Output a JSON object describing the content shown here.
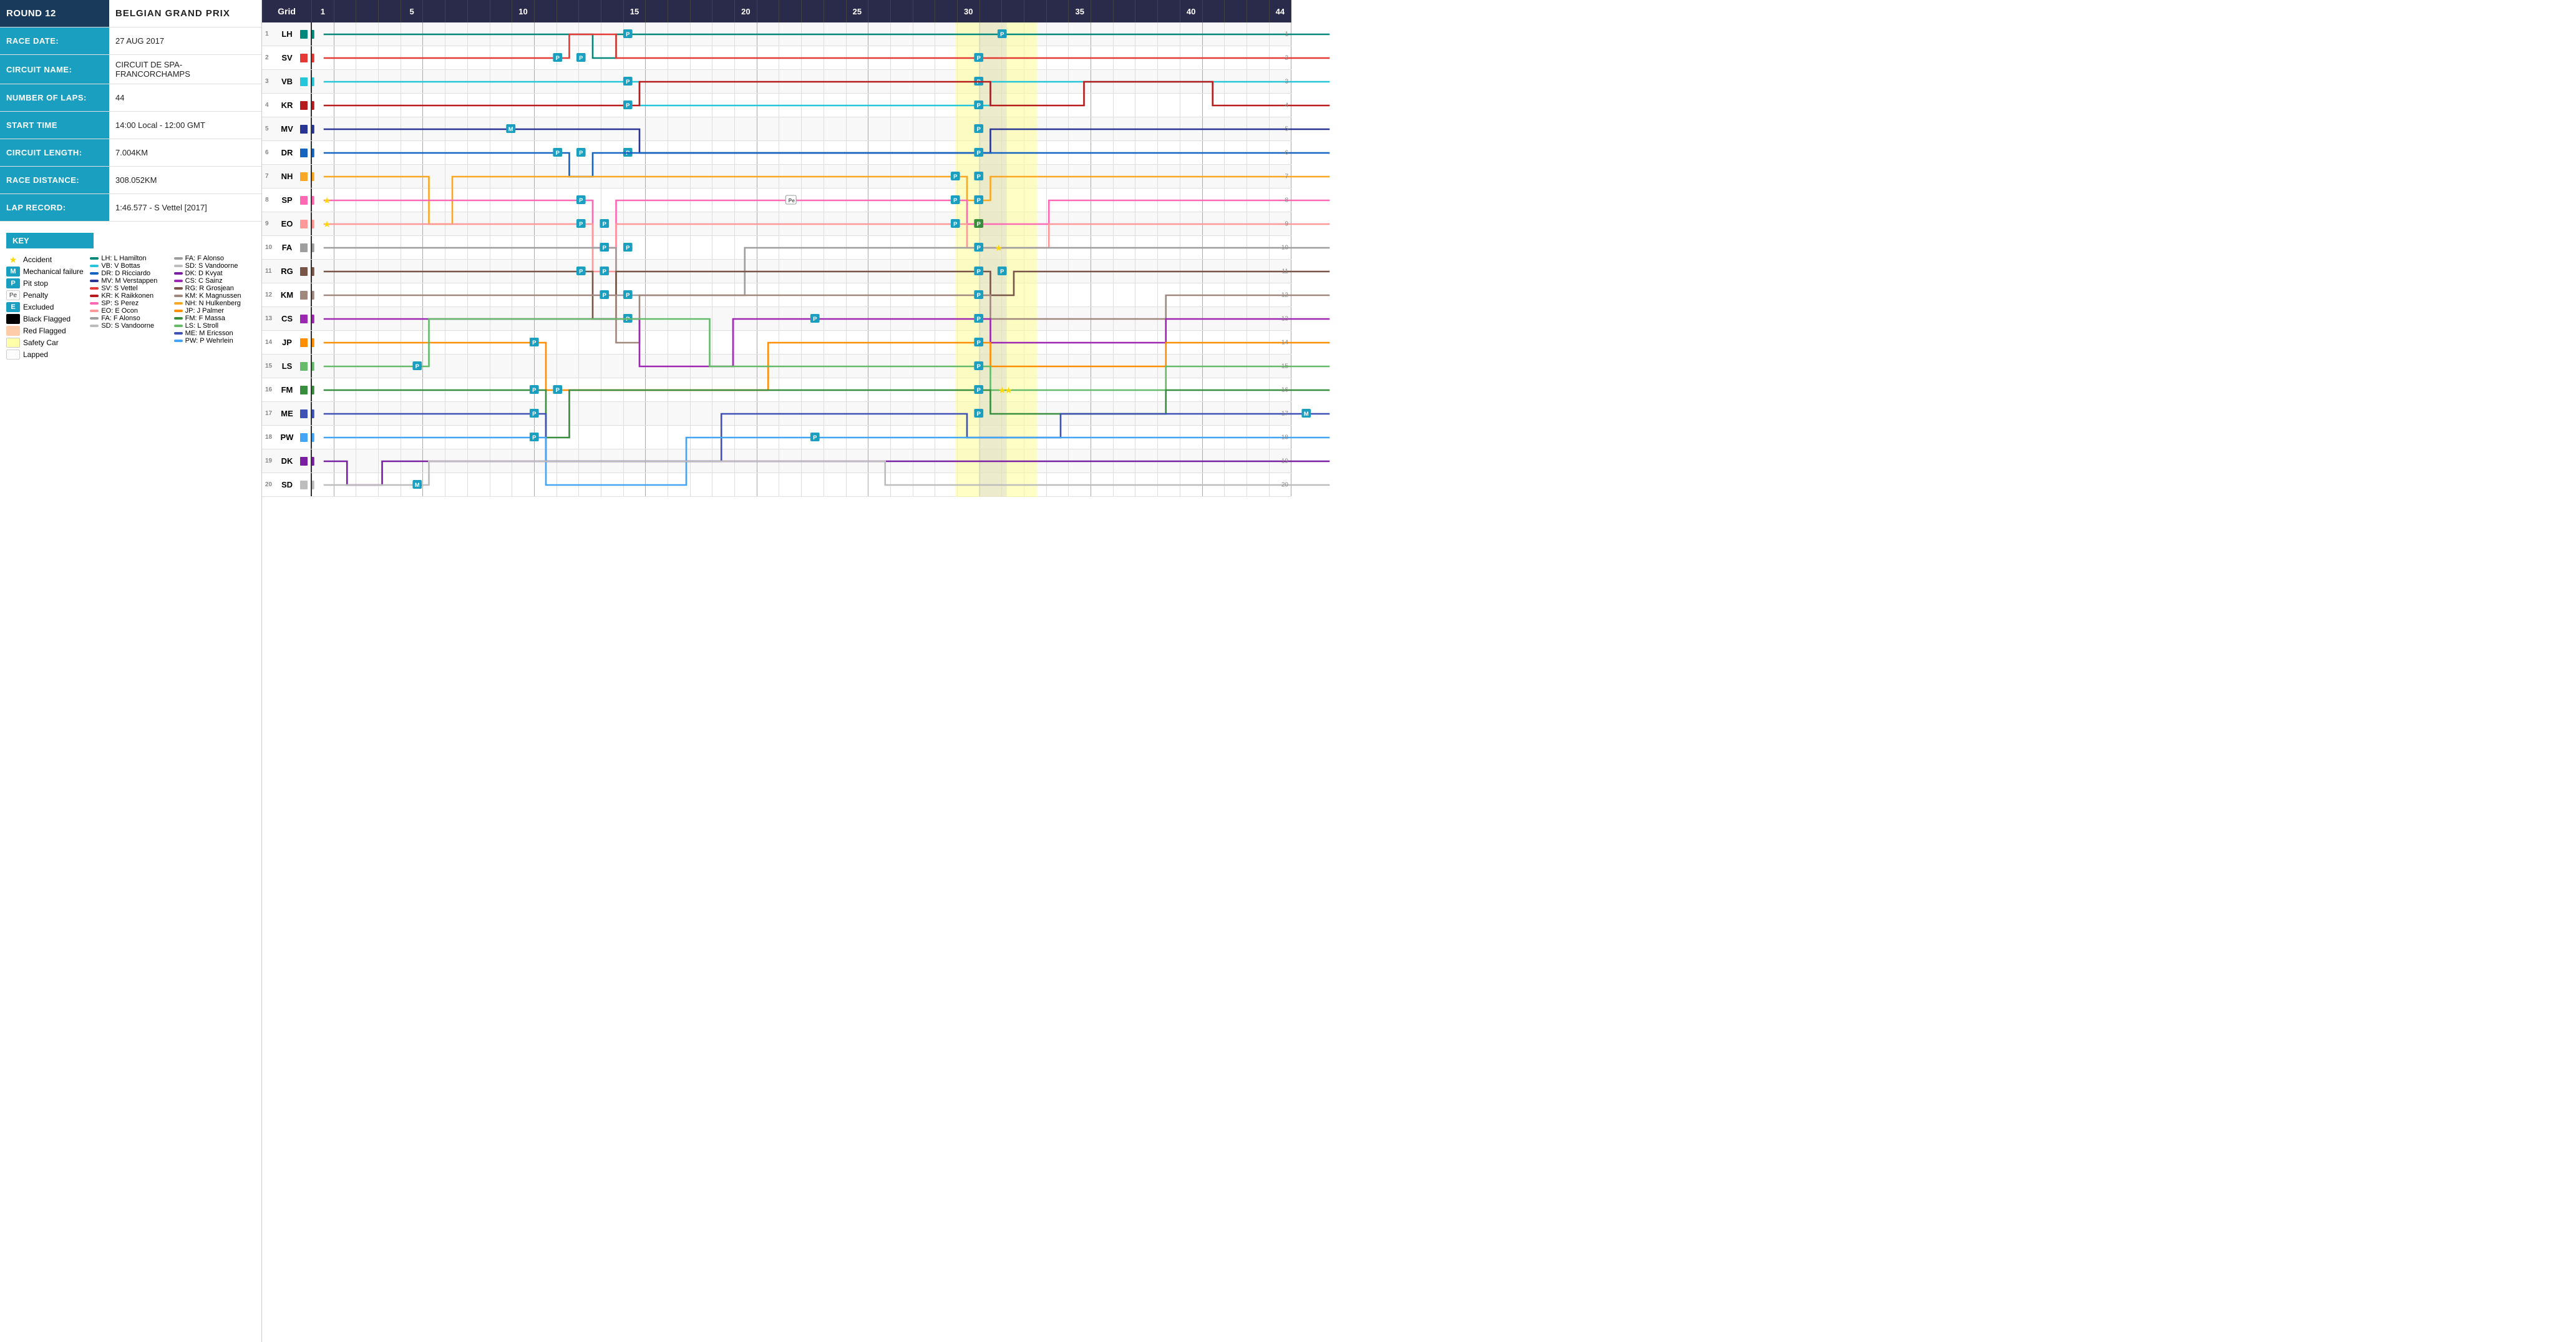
{
  "round": {
    "label": "ROUND 12",
    "name": "BELGIAN GRAND PRIX"
  },
  "raceDate": {
    "label": "RACE DATE:",
    "value": "27 AUG 2017"
  },
  "circuitName": {
    "label": "CIRCUIT NAME:",
    "value": "CIRCUIT DE SPA-FRANCORCHAMPS"
  },
  "numberOfLaps": {
    "label": "NUMBER OF LAPS:",
    "value": "44"
  },
  "startTime": {
    "label": "START TIME",
    "value": "14:00 Local - 12:00 GMT"
  },
  "circuitLength": {
    "label": "CIRCUIT LENGTH:",
    "value": "7.004KM"
  },
  "raceDistance": {
    "label": "RACE DISTANCE:",
    "value": "308.052KM"
  },
  "lapRecord": {
    "label": "LAP RECORD:",
    "value": "1:46.577 - S Vettel [2017]"
  },
  "key": {
    "title": "KEY",
    "items": [
      {
        "id": "accident",
        "icon": "star",
        "label": "Accident"
      },
      {
        "id": "mechanical",
        "icon": "M",
        "label": "Mechanical failure"
      },
      {
        "id": "pitstop",
        "icon": "P",
        "label": "Pit stop"
      },
      {
        "id": "penalty",
        "icon": "Pe",
        "label": "Penalty"
      },
      {
        "id": "excluded",
        "icon": "E",
        "label": "Excluded"
      },
      {
        "id": "blackflag",
        "icon": "black",
        "label": "Black Flagged"
      },
      {
        "id": "redflag",
        "icon": "red",
        "label": "Red Flagged"
      },
      {
        "id": "safetycar",
        "icon": "yellow",
        "label": "Safety Car"
      },
      {
        "id": "lapped",
        "icon": "white",
        "label": "Lapped"
      }
    ],
    "drivers": [
      {
        "code": "LH",
        "name": "L Hamilton",
        "color": "#00897B"
      },
      {
        "code": "VB",
        "name": "V Bottas",
        "color": "#26C6DA"
      },
      {
        "code": "DR",
        "name": "D Ricciardo",
        "color": "#1565C0"
      },
      {
        "code": "MV",
        "name": "M Verstappen",
        "color": "#283593"
      },
      {
        "code": "SV",
        "name": "S Vettel",
        "color": "#E53935"
      },
      {
        "code": "KR",
        "name": "K Raikkonen",
        "color": "#B71C1C"
      },
      {
        "code": "SP",
        "name": "S Perez",
        "color": "#FF69B4"
      },
      {
        "code": "EO",
        "name": "E Ocon",
        "color": "#FF9999"
      },
      {
        "code": "FA",
        "name": "F Alonso",
        "color": "#9E9E9E"
      },
      {
        "code": "SD",
        "name": "S Vandoorne",
        "color": "#BDBDBD"
      },
      {
        "code": "DK",
        "name": "D Kvyat",
        "color": "#7B1FA2"
      },
      {
        "code": "CS",
        "name": "C Sainz",
        "color": "#9C27B0"
      },
      {
        "code": "RG",
        "name": "R Grosjean",
        "color": "#795548"
      },
      {
        "code": "KM",
        "name": "K Magnussen",
        "color": "#A1887F"
      },
      {
        "code": "NH",
        "name": "N Hulkenberg",
        "color": "#F9A825"
      },
      {
        "code": "JP",
        "name": "J Palmer",
        "color": "#FF8F00"
      },
      {
        "code": "FM",
        "name": "F Massa",
        "color": "#388E3C"
      },
      {
        "code": "LS",
        "name": "L Stroll",
        "color": "#66BB6A"
      },
      {
        "code": "ME",
        "name": "M Ericsson",
        "color": "#3F51B5"
      },
      {
        "code": "PW",
        "name": "P Wehrlein",
        "color": "#42A5F5"
      }
    ]
  },
  "chart": {
    "gridLabel": "Grid",
    "totalLaps": 44,
    "majorLaps": [
      1,
      5,
      10,
      15,
      20,
      25,
      30,
      35,
      40,
      44
    ],
    "drivers": [
      {
        "pos": 1,
        "code": "LH",
        "color": "#00897B",
        "startFlag": "#00897B"
      },
      {
        "pos": 2,
        "code": "SV",
        "color": "#E53935",
        "startFlag": "#E53935"
      },
      {
        "pos": 3,
        "code": "VB",
        "color": "#26C6DA",
        "startFlag": "#26C6DA"
      },
      {
        "pos": 4,
        "code": "KR",
        "color": "#B71C1C",
        "startFlag": "#B71C1C"
      },
      {
        "pos": 5,
        "code": "MV",
        "color": "#283593",
        "startFlag": "#283593"
      },
      {
        "pos": 6,
        "code": "DR",
        "color": "#1565C0",
        "startFlag": "#1565C0"
      },
      {
        "pos": 7,
        "code": "NH",
        "color": "#F9A825",
        "startFlag": "#F9A825"
      },
      {
        "pos": 8,
        "code": "SP",
        "color": "#FF69B4",
        "startFlag": "#FF69B4"
      },
      {
        "pos": 9,
        "code": "EO",
        "color": "#FF9999",
        "startFlag": "#FF9999"
      },
      {
        "pos": 10,
        "code": "FA",
        "color": "#9E9E9E",
        "startFlag": "#9E9E9E"
      },
      {
        "pos": 11,
        "code": "RG",
        "color": "#795548",
        "startFlag": "#795548"
      },
      {
        "pos": 12,
        "code": "KM",
        "color": "#A1887F",
        "startFlag": "#A1887F"
      },
      {
        "pos": 13,
        "code": "CS",
        "color": "#9C27B0",
        "startFlag": "#9C27B0"
      },
      {
        "pos": 14,
        "code": "JP",
        "color": "#FF8F00",
        "startFlag": "#FF8F00"
      },
      {
        "pos": 15,
        "code": "LS",
        "color": "#66BB6A",
        "startFlag": "#66BB6A"
      },
      {
        "pos": 16,
        "code": "FM",
        "color": "#388E3C",
        "startFlag": "#388E3C"
      },
      {
        "pos": 17,
        "code": "ME",
        "color": "#3F51B5",
        "startFlag": "#3F51B5"
      },
      {
        "pos": 18,
        "code": "PW",
        "color": "#42A5F5",
        "startFlag": "#42A5F5"
      },
      {
        "pos": 19,
        "code": "DK",
        "color": "#7B1FA2",
        "startFlag": "#7B1FA2"
      },
      {
        "pos": 20,
        "code": "SD",
        "color": "#BDBDBD",
        "startFlag": "#BDBDBD"
      }
    ]
  }
}
